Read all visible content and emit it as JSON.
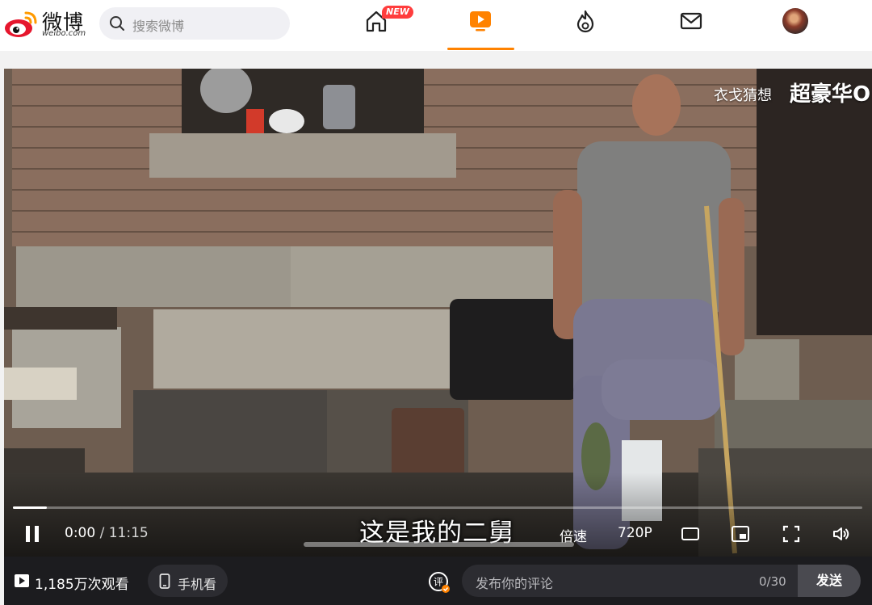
{
  "header": {
    "logo_text": "微博",
    "logo_sub": "weibo.com",
    "search_placeholder": "搜索微博",
    "nav": [
      {
        "icon": "home-icon",
        "badge": "NEW"
      },
      {
        "icon": "video-play-icon",
        "active": true
      },
      {
        "icon": "hot-flame-icon"
      },
      {
        "icon": "mail-icon"
      }
    ],
    "accent_color": "#ff8200"
  },
  "video": {
    "watermark_small": "衣戈猜想",
    "watermark_big": "超豪华O",
    "subtitle": "这是我的二舅",
    "current_time": "0:00",
    "separator": "/",
    "duration": "11:15",
    "progress_fraction": 0.04,
    "speed_label": "倍速",
    "quality_label": "720P"
  },
  "footer": {
    "views": "1,185万次观看",
    "mobile_watch": "手机看",
    "comment_placeholder": "发布你的评论",
    "comment_count": "0/30",
    "send_label": "发送"
  }
}
